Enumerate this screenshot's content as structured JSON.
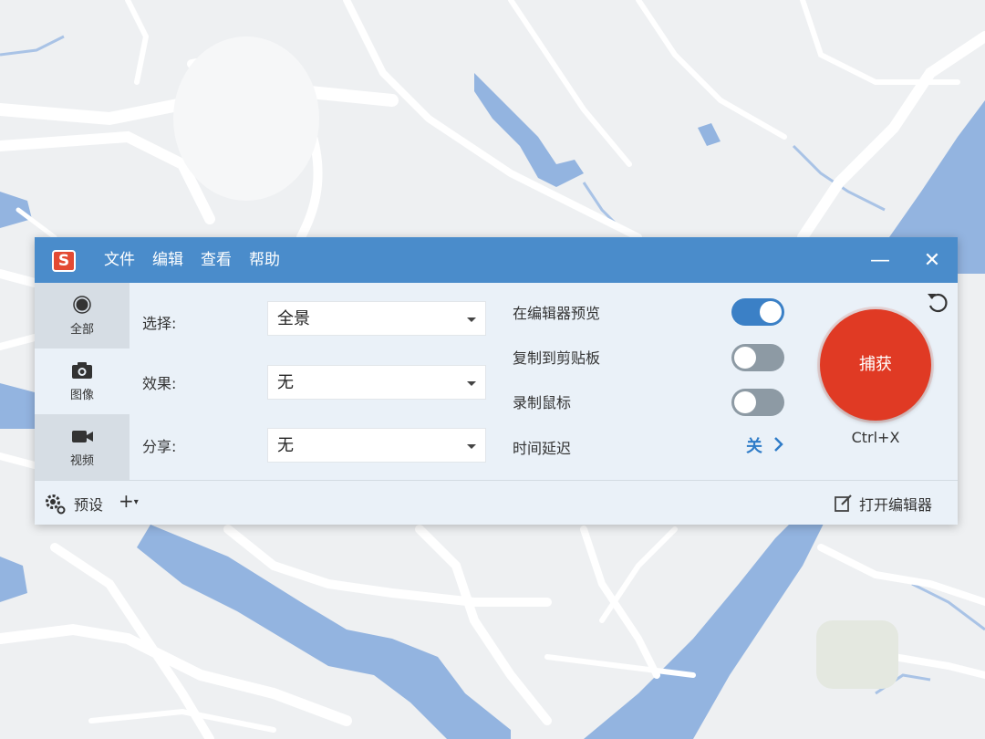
{
  "titlebar": {
    "logo_letter": "S",
    "menu": [
      "文件",
      "编辑",
      "查看",
      "帮助"
    ],
    "minimize_glyph": "—",
    "close_glyph": "✕"
  },
  "modes": [
    {
      "label": "全部",
      "icon": "record-circle-icon",
      "active": true
    },
    {
      "label": "图像",
      "icon": "camera-icon",
      "active": false
    },
    {
      "label": "视频",
      "icon": "video-camera-icon",
      "active": false
    }
  ],
  "fields": {
    "select": {
      "label": "选择:",
      "value": "全景"
    },
    "effect": {
      "label": "效果:",
      "value": "无"
    },
    "share": {
      "label": "分享:",
      "value": "无"
    }
  },
  "options": {
    "preview": {
      "label": "在编辑器预览",
      "on": true
    },
    "clipboard": {
      "label": "复制到剪贴板",
      "on": false
    },
    "cursor": {
      "label": "录制鼠标",
      "on": false
    },
    "delay": {
      "label": "时间延迟",
      "value": "关"
    }
  },
  "capture": {
    "label": "捕获",
    "hotkey": "Ctrl+X"
  },
  "footer": {
    "preset_label": "预设",
    "add_label": "+",
    "open_editor_label": "打开编辑器"
  },
  "colors": {
    "titlebar": "#4a8ccb",
    "capture": "#e03a24",
    "toggle_on": "#3b80c6",
    "toggle_off": "#8d9aa4",
    "map_water": "#93b4e0"
  }
}
